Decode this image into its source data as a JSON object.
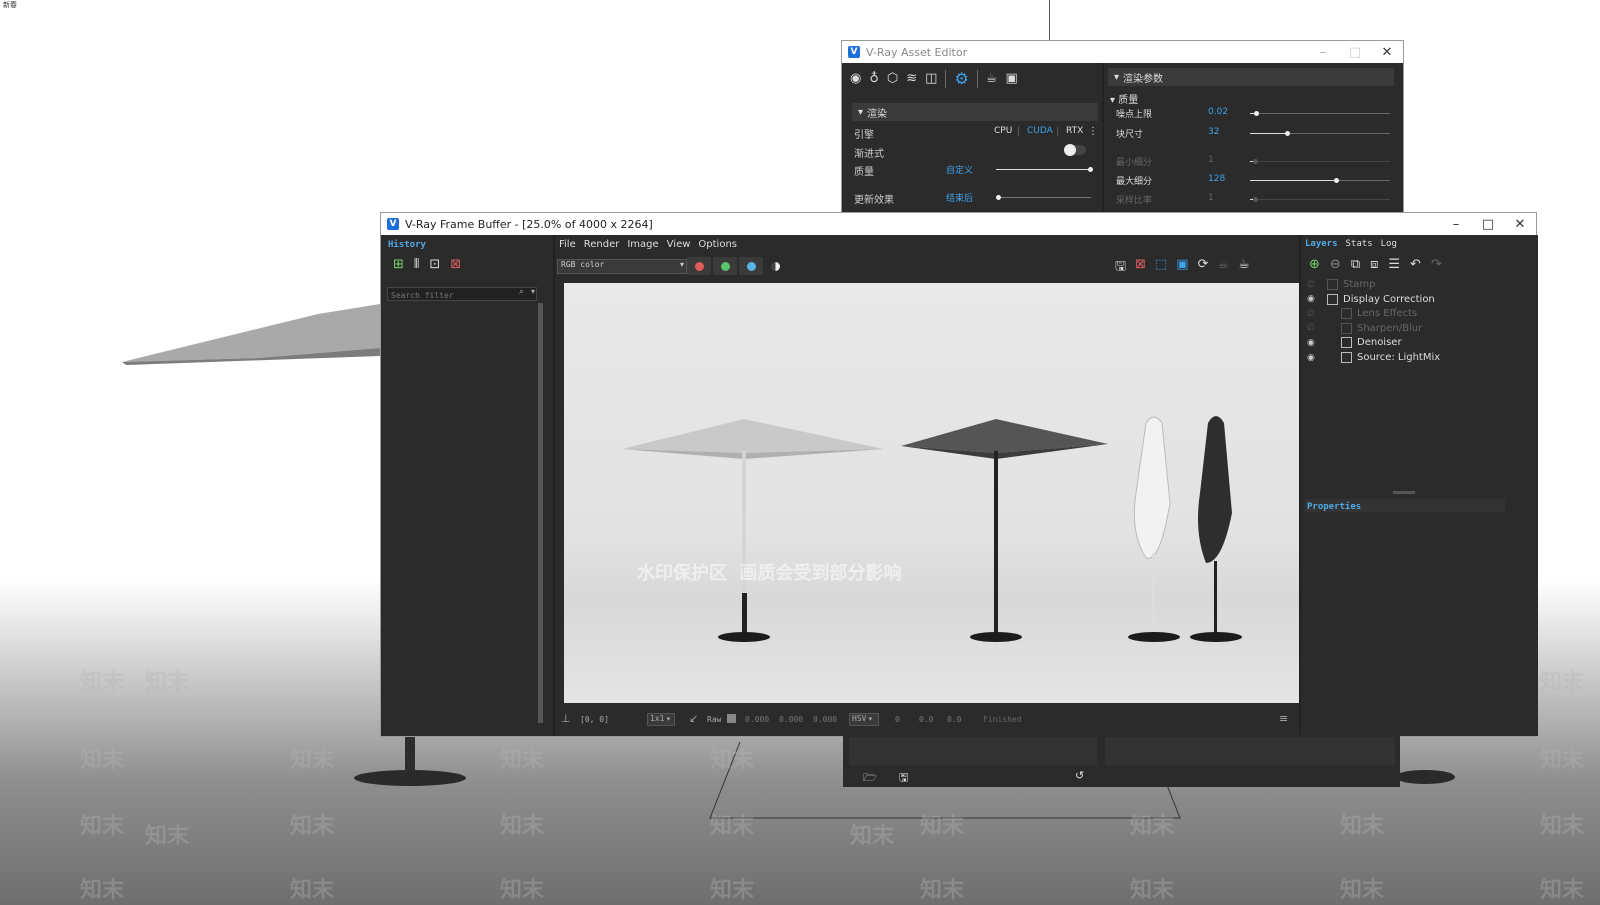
{
  "corner_label": "新春",
  "asset_editor": {
    "title": "V-Ray Asset Editor",
    "left_section": "渲染",
    "engine_label": "引擎",
    "engines": [
      "CPU",
      "CUDA",
      "RTX"
    ],
    "progressive_label": "渐进式",
    "quality_label": "质量",
    "quality_value": "自定义",
    "update_label": "更新效果",
    "update_value": "结束后",
    "right_section": "渲染参数",
    "quality_section": "质量",
    "params": [
      {
        "label": "噪点上限",
        "value": "0.02",
        "level": 0.03
      },
      {
        "label": "块尺寸",
        "value": "32",
        "level": 0.25
      },
      {
        "label": "最小细分",
        "value": "1",
        "level": 0.02
      },
      {
        "label": "最大细分",
        "value": "128",
        "level": 0.6
      },
      {
        "label": "采样比率",
        "value": "1",
        "level": 0.02
      }
    ]
  },
  "vfb": {
    "title": "V-Ray Frame Buffer - [25.0% of 4000 x 2264]",
    "history_tab": "History",
    "search_placeholder": "Search filter",
    "menu": [
      "File",
      "Render",
      "Image",
      "View",
      "Options"
    ],
    "channel": "RGB color",
    "layers_tab": "Layers",
    "stats_tab": "Stats",
    "log_tab": "Log",
    "layers": [
      {
        "name": "Stamp",
        "visible": false,
        "indent": 0
      },
      {
        "name": "Display Correction",
        "visible": true,
        "indent": 0
      },
      {
        "name": "Lens Effects",
        "visible": false,
        "indent": 1
      },
      {
        "name": "Sharpen/Blur",
        "visible": false,
        "indent": 1
      },
      {
        "name": "Denoiser",
        "visible": true,
        "indent": 1
      },
      {
        "name": "Source: LightMix",
        "visible": true,
        "indent": 1
      }
    ],
    "properties_tab": "Properties",
    "coords": "[0, 0]",
    "zoom": "1x1",
    "raw_label": "Raw",
    "raw_values": [
      "0.000",
      "0.000",
      "0.000"
    ],
    "color_mode": "HSV",
    "hsv_values": [
      "0",
      "0.0",
      "0.0"
    ],
    "status": "Finished",
    "watermark": "水印保护区  画质会受到部分影响"
  },
  "bg_watermark": "知末",
  "colors": {
    "accent": "#3fa2ea",
    "panel": "#2b2b2b",
    "red": "#e05a5a",
    "green": "#5ac46a",
    "blue": "#5ab4e8"
  }
}
